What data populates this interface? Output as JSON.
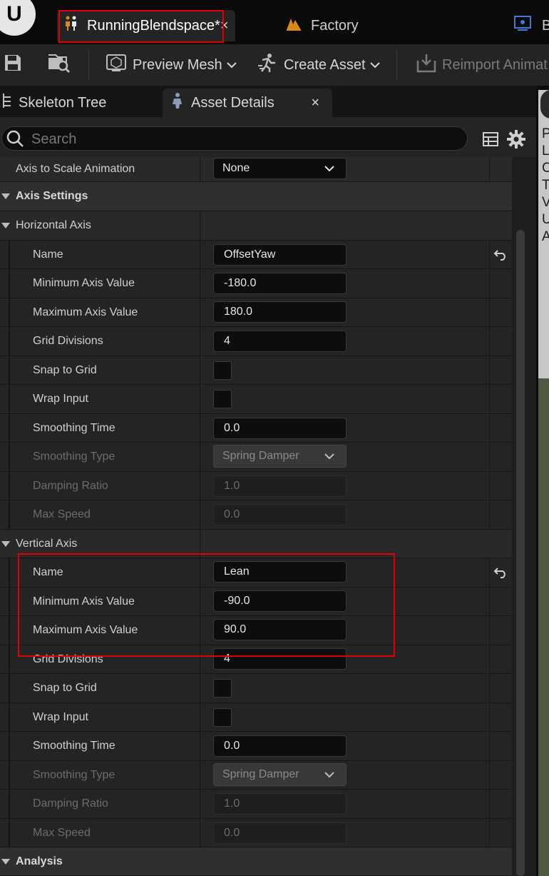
{
  "title_bar": {
    "tabs": [
      {
        "label": "RunningBlendspace*",
        "close": "×"
      },
      {
        "label": "Factory"
      },
      {
        "label": "B"
      }
    ]
  },
  "toolbar": {
    "preview_mesh": "Preview Mesh",
    "create_asset": "Create Asset",
    "reimport": "Reimport Animat"
  },
  "panel_tabs": {
    "skeleton_tree": "Skeleton Tree",
    "asset_details": "Asset Details",
    "close": "×"
  },
  "search": {
    "placeholder": "Search"
  },
  "details": {
    "axis_to_scale": {
      "label": "Axis to Scale Animation",
      "value": "None"
    },
    "axis_settings": "Axis Settings",
    "horizontal": {
      "header": "Horizontal Axis",
      "name_label": "Name",
      "name_value": "OffsetYaw",
      "min_label": "Minimum Axis Value",
      "min_value": "-180.0",
      "max_label": "Maximum Axis Value",
      "max_value": "180.0",
      "grid_label": "Grid Divisions",
      "grid_value": "4",
      "snap_label": "Snap to Grid",
      "snap_checked": false,
      "wrap_label": "Wrap Input",
      "wrap_checked": false,
      "smooth_time_label": "Smoothing Time",
      "smooth_time_value": "0.0",
      "smooth_type_label": "Smoothing Type",
      "smooth_type_value": "Spring Damper",
      "damping_label": "Damping Ratio",
      "damping_value": "1.0",
      "max_speed_label": "Max Speed",
      "max_speed_value": "0.0"
    },
    "vertical": {
      "header": "Vertical Axis",
      "name_label": "Name",
      "name_value": "Lean",
      "min_label": "Minimum Axis Value",
      "min_value": "-90.0",
      "max_label": "Maximum Axis Value",
      "max_value": "90.0",
      "grid_label": "Grid Divisions",
      "grid_value": "4",
      "snap_label": "Snap to Grid",
      "snap_checked": false,
      "wrap_label": "Wrap Input",
      "wrap_checked": false,
      "smooth_time_label": "Smoothing Time",
      "smooth_time_value": "0.0",
      "smooth_type_label": "Smoothing Type",
      "smooth_type_value": "Spring Damper",
      "damping_label": "Damping Ratio",
      "damping_value": "1.0",
      "max_speed_label": "Max Speed",
      "max_speed_value": "0.0"
    },
    "analysis": "Analysis"
  },
  "viewport_text": "P L C T V U A",
  "colors": {
    "highlight": "#e00000",
    "factory_icon": "#d98b1a",
    "accent_blue": "#3d7bd9"
  }
}
